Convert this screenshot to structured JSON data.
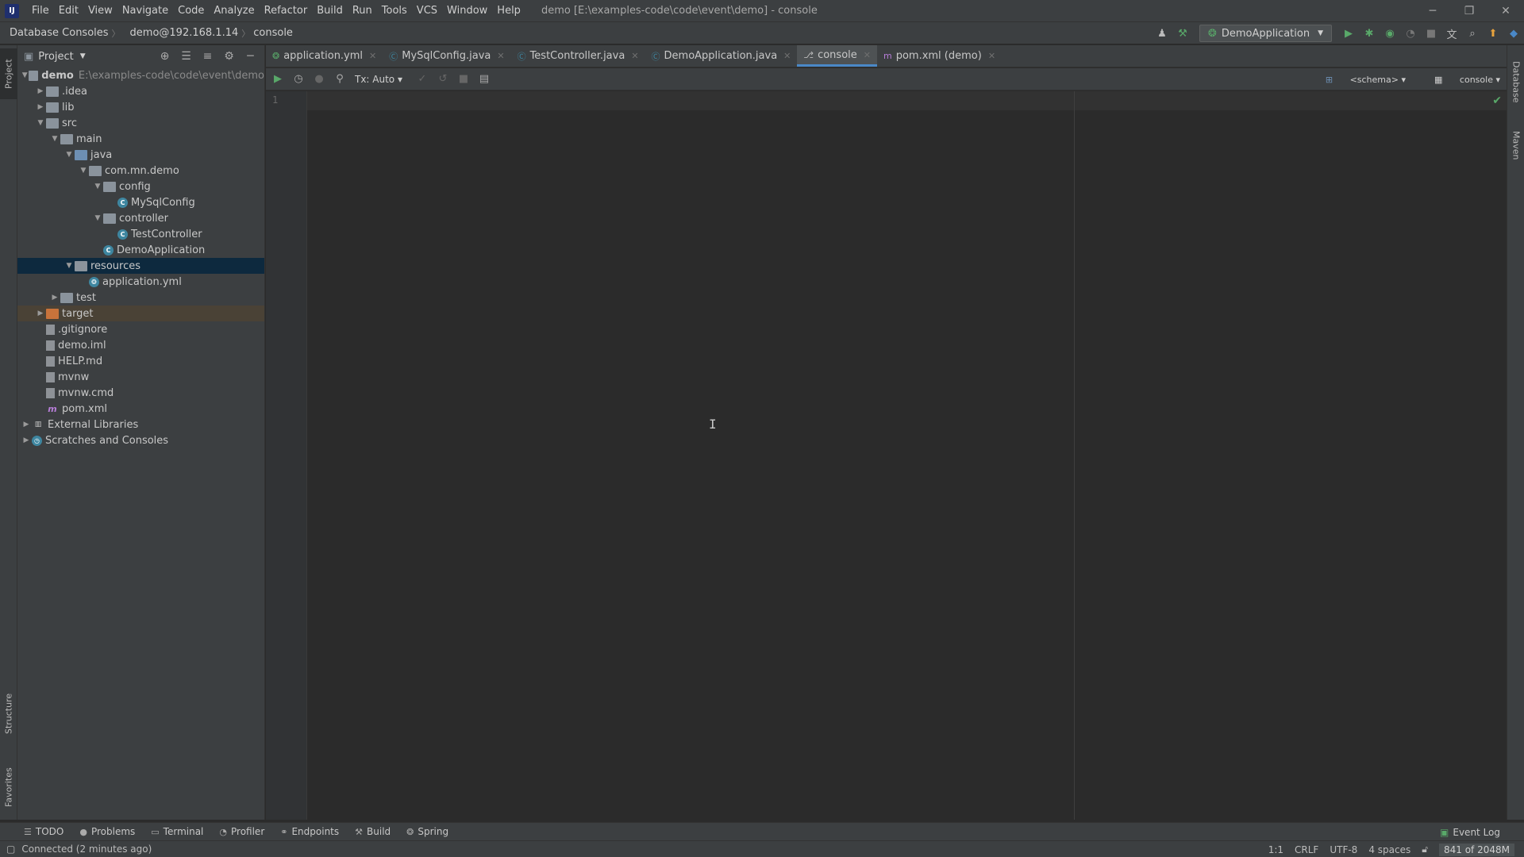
{
  "window": {
    "title": "demo [E:\\examples-code\\code\\event\\demo] - console",
    "logo": "IJ",
    "minimize": "─",
    "restore": "❐",
    "close": "✕"
  },
  "menu": [
    "File",
    "Edit",
    "View",
    "Navigate",
    "Code",
    "Analyze",
    "Refactor",
    "Build",
    "Run",
    "Tools",
    "VCS",
    "Window",
    "Help"
  ],
  "breadcrumb": [
    "Database Consoles",
    "demo@192.168.1.14",
    "console"
  ],
  "run_config": "DemoApplication",
  "project_panel": {
    "title": "Project",
    "tree": [
      {
        "label": "demo",
        "path": "E:\\examples-code\\code\\event\\demo",
        "depth": 0,
        "arrow": "v",
        "icon": "folder"
      },
      {
        "label": ".idea",
        "depth": 1,
        "arrow": ">",
        "icon": "folder"
      },
      {
        "label": "lib",
        "depth": 1,
        "arrow": ">",
        "icon": "folder"
      },
      {
        "label": "src",
        "depth": 1,
        "arrow": "v",
        "icon": "folder"
      },
      {
        "label": "main",
        "depth": 2,
        "arrow": "v",
        "icon": "folder"
      },
      {
        "label": "java",
        "depth": 3,
        "arrow": "v",
        "icon": "folder-blue"
      },
      {
        "label": "com.mn.demo",
        "depth": 4,
        "arrow": "v",
        "icon": "folder"
      },
      {
        "label": "config",
        "depth": 5,
        "arrow": "v",
        "icon": "folder"
      },
      {
        "label": "MySqlConfig",
        "depth": 6,
        "arrow": "",
        "icon": "class"
      },
      {
        "label": "controller",
        "depth": 5,
        "arrow": "v",
        "icon": "folder"
      },
      {
        "label": "TestController",
        "depth": 6,
        "arrow": "",
        "icon": "class"
      },
      {
        "label": "DemoApplication",
        "depth": 5,
        "arrow": "",
        "icon": "class"
      },
      {
        "label": "resources",
        "depth": 3,
        "arrow": "v",
        "icon": "folder",
        "selected": true
      },
      {
        "label": "application.yml",
        "depth": 4,
        "arrow": "",
        "icon": "yml"
      },
      {
        "label": "test",
        "depth": 2,
        "arrow": ">",
        "icon": "folder"
      },
      {
        "label": "target",
        "depth": 1,
        "arrow": ">",
        "icon": "folder-orange",
        "target": true
      },
      {
        "label": ".gitignore",
        "depth": 1,
        "arrow": "",
        "icon": "file"
      },
      {
        "label": "demo.iml",
        "depth": 1,
        "arrow": "",
        "icon": "file"
      },
      {
        "label": "HELP.md",
        "depth": 1,
        "arrow": "",
        "icon": "file"
      },
      {
        "label": "mvnw",
        "depth": 1,
        "arrow": "",
        "icon": "file"
      },
      {
        "label": "mvnw.cmd",
        "depth": 1,
        "arrow": "",
        "icon": "file"
      },
      {
        "label": "pom.xml",
        "depth": 1,
        "arrow": "",
        "icon": "maven"
      },
      {
        "label": "External Libraries",
        "depth": 0,
        "arrow": ">",
        "icon": "lib"
      },
      {
        "label": "Scratches and Consoles",
        "depth": 0,
        "arrow": ">",
        "icon": "scratch"
      }
    ]
  },
  "tabs": [
    {
      "label": "application.yml",
      "icon": "yml-icon"
    },
    {
      "label": "MySqlConfig.java",
      "icon": "class-icon"
    },
    {
      "label": "TestController.java",
      "icon": "class-icon"
    },
    {
      "label": "DemoApplication.java",
      "icon": "class-icon"
    },
    {
      "label": "console",
      "icon": "console-icon",
      "active": true
    },
    {
      "label": "pom.xml (demo)",
      "icon": "maven-icon"
    }
  ],
  "console_toolbar": {
    "tx_mode": "Tx: Auto",
    "schema": "<schema>",
    "session": "console"
  },
  "editor": {
    "line_number": "1"
  },
  "side_tabs": {
    "left_top": "Project",
    "left_structure": "Structure",
    "left_favorites": "Favorites",
    "right_database": "Database",
    "right_maven": "Maven"
  },
  "bottom_tools": [
    "TODO",
    "Problems",
    "Terminal",
    "Profiler",
    "Endpoints",
    "Build",
    "Spring"
  ],
  "event_log": "Event Log",
  "status": {
    "message": "Connected (2 minutes ago)",
    "position": "1:1",
    "line_sep": "CRLF",
    "encoding": "UTF-8",
    "indent": "4 spaces",
    "memory": "841 of 2048M"
  },
  "colors": {
    "accent": "#4a88c7",
    "selection": "#0d293e",
    "run_green": "#59a869"
  }
}
